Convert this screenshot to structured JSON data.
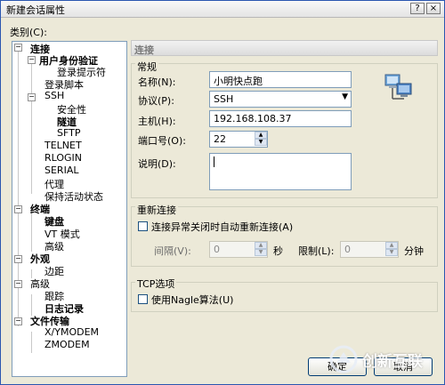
{
  "window": {
    "title": "新建会话属性",
    "help_button": "?",
    "close_button": "×"
  },
  "category_label": "类别(C):",
  "tree": [
    {
      "label": "连接",
      "bold": true
    },
    {
      "label": "用户身份验证",
      "bold": true
    },
    {
      "label": "登录提示符",
      "bold": false
    },
    {
      "label": "登录脚本",
      "bold": false
    },
    {
      "label": "SSH",
      "bold": false
    },
    {
      "label": "安全性",
      "bold": false
    },
    {
      "label": "隧道",
      "bold": true
    },
    {
      "label": "SFTP",
      "bold": false
    },
    {
      "label": "TELNET",
      "bold": false
    },
    {
      "label": "RLOGIN",
      "bold": false
    },
    {
      "label": "SERIAL",
      "bold": false
    },
    {
      "label": "代理",
      "bold": false
    },
    {
      "label": "保持活动状态",
      "bold": false
    },
    {
      "label": "终端",
      "bold": true
    },
    {
      "label": "键盘",
      "bold": true
    },
    {
      "label": "VT 模式",
      "bold": false
    },
    {
      "label": "高级",
      "bold": false
    },
    {
      "label": "外观",
      "bold": true
    },
    {
      "label": "边距",
      "bold": false
    },
    {
      "label": "高级",
      "bold": false
    },
    {
      "label": "跟踪",
      "bold": false
    },
    {
      "label": "日志记录",
      "bold": true
    },
    {
      "label": "文件传输",
      "bold": true
    },
    {
      "label": "X/YMODEM",
      "bold": false
    },
    {
      "label": "ZMODEM",
      "bold": false
    }
  ],
  "panel": {
    "header": "连接",
    "general": {
      "title": "常规",
      "name_label": "名称(N):",
      "name_value": "小明快点跑",
      "protocol_label": "协议(P):",
      "protocol_value": "SSH",
      "host_label": "主机(H):",
      "host_value": "192.168.108.37",
      "port_label": "端口号(O):",
      "port_value": "22",
      "desc_label": "说明(D):",
      "desc_value": ""
    },
    "reconnect": {
      "title": "重新连接",
      "auto_reconnect_label": "连接异常关闭时自动重新连接(A)",
      "interval_label": "间隔(V):",
      "interval_value": "0",
      "interval_unit": "秒",
      "limit_label": "限制(L):",
      "limit_value": "0",
      "limit_unit": "分钟"
    },
    "tcp": {
      "title": "TCP选项",
      "nagle_label": "使用Nagle算法(U)"
    }
  },
  "buttons": {
    "ok": "确定",
    "cancel": "取消"
  },
  "watermark": "创新互联"
}
